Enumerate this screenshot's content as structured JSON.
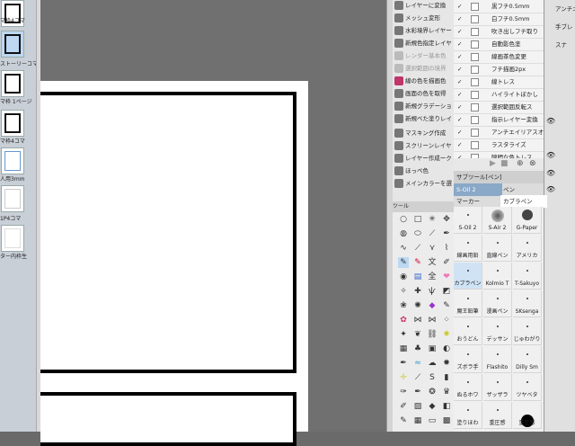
{
  "left_strip": {
    "items": [
      {
        "label": "マ枠4コマ"
      },
      {
        "label": "ストーリーコマ"
      },
      {
        "label": "マ枠 1ページ"
      },
      {
        "label": "マ枠4コマ"
      },
      {
        "label": "人用3mm"
      },
      {
        "label": "1P4コマ"
      },
      {
        "label": "ター内枠生"
      }
    ]
  },
  "tool_list": [
    {
      "label": "レイヤーに変換"
    },
    {
      "label": "メッシュ変形"
    },
    {
      "label": "水彩境界レイヤー"
    },
    {
      "label": "新規色指定レイヤー"
    },
    {
      "label": "レンダー基本色"
    },
    {
      "label": "選択範囲の境界"
    },
    {
      "label": "線の色を描画色"
    },
    {
      "label": "画面の色を取得"
    },
    {
      "label": "新規グラデーション"
    },
    {
      "label": "新規べた塗りレイヤー"
    },
    {
      "label": "マスキング作成"
    },
    {
      "label": "スクリーンレイヤー"
    },
    {
      "label": "レイヤー作成ーク"
    },
    {
      "label": "ほっぺ色"
    },
    {
      "label": "メインカラーを選択"
    }
  ],
  "checklist": [
    {
      "label": "黒フチ0.5mm"
    },
    {
      "label": "白フチ0.5mm"
    },
    {
      "label": "吹き出しフチ取り"
    },
    {
      "label": "自動影色塗"
    },
    {
      "label": "線画茶色変更"
    },
    {
      "label": "フチ描画2px"
    },
    {
      "label": "線トレス"
    },
    {
      "label": "ハイライトぼかし"
    },
    {
      "label": "選択範囲反転ス"
    },
    {
      "label": "指示レイヤー変換"
    },
    {
      "label": "アンチエイリアスオン"
    },
    {
      "label": "ラスタライズ"
    },
    {
      "label": "隙間な色トレス"
    }
  ],
  "far_right": {
    "line1": "アンチエ",
    "line2": "手ブレ",
    "line3": "スナ"
  },
  "subtool": {
    "header": "サブツール[ペン]",
    "tab1": "S-Oil 2",
    "tab2": "ペン",
    "tab3": "マーカー",
    "tab4": "カブラペン"
  },
  "tool_header": "ツール",
  "brushes": [
    {
      "label": "S-Oil 2"
    },
    {
      "label": "S-Air 2"
    },
    {
      "label": "G-Paper"
    },
    {
      "label": "線画用鉛"
    },
    {
      "label": "直線ペン"
    },
    {
      "label": "アメリカ"
    },
    {
      "label": "カブラペン"
    },
    {
      "label": "Kolmio T"
    },
    {
      "label": "T-Sakuyo"
    },
    {
      "label": "魔王鉛筆"
    },
    {
      "label": "漫画ペン"
    },
    {
      "label": "SKsenga"
    },
    {
      "label": "おうどん"
    },
    {
      "label": "デッサン"
    },
    {
      "label": "じゅわがり"
    },
    {
      "label": "ズボラ手"
    },
    {
      "label": "Flashito"
    },
    {
      "label": "Dilly Sm"
    },
    {
      "label": "ぬるホワ"
    },
    {
      "label": "ザッザラ"
    },
    {
      "label": "ツヤベタ"
    },
    {
      "label": "塗りほわ"
    },
    {
      "label": "重圧感"
    },
    {
      "label": "重圧感"
    }
  ],
  "colors": {
    "accent": "#bcd8f2",
    "panel": "#ececec",
    "canvas": "#707070"
  }
}
